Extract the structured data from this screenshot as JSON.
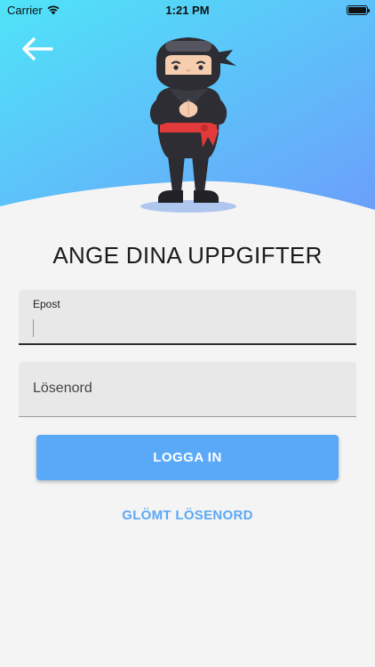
{
  "status_bar": {
    "carrier": "Carrier",
    "time": "1:21 PM"
  },
  "header": {
    "gradient_start": "#4fe0f8",
    "gradient_end": "#6aa4fa",
    "back_icon": "arrow-left-icon",
    "mascot": "ninja-icon"
  },
  "form": {
    "title": "ANGE DINA UPPGIFTER",
    "email_label": "Epost",
    "email_value": "",
    "password_placeholder": "Lösenord",
    "password_value": "",
    "login_label": "LOGGA IN",
    "forgot_label": "GLÖMT LÖSENORD"
  },
  "colors": {
    "accent": "#5aa9f8",
    "background": "#f4f4f4",
    "field_background": "#e8e8e8"
  }
}
